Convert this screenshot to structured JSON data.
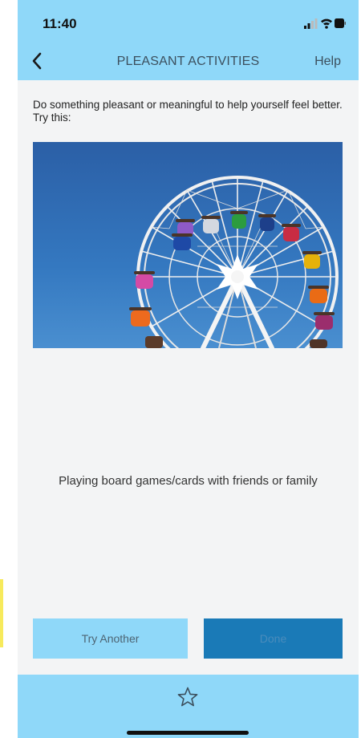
{
  "status_bar": {
    "time": "11:40",
    "icons": [
      "signal-icon",
      "wifi-icon",
      "battery-icon"
    ]
  },
  "nav": {
    "back_icon": "chevron-left-icon",
    "title": "PLEASANT ACTIVITIES",
    "help_label": "Help"
  },
  "content": {
    "intro": "Do something pleasant or meaningful to help yourself feel better.  Try this:",
    "image_subject": "ferris-wheel-photo",
    "activity": "Playing board games/cards with friends or family"
  },
  "actions": {
    "try_another_label": "Try Another",
    "done_label": "Done"
  },
  "tab_bar": {
    "favorite_icon": "star-icon"
  },
  "colors": {
    "header_bg": "#8fd8f9",
    "done_bg": "#1a7ab7",
    "page_bg": "#f3f4f5"
  }
}
